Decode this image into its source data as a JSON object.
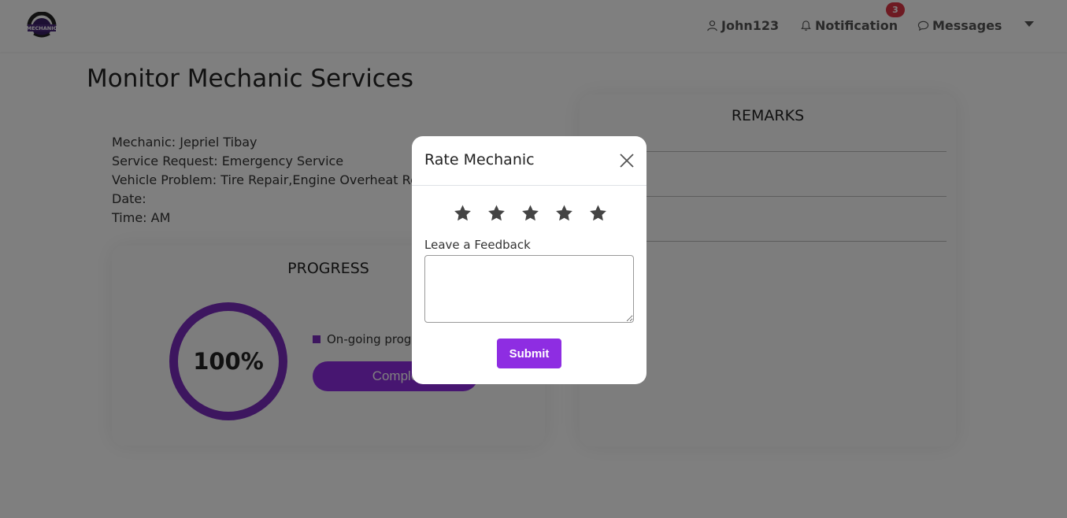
{
  "navbar": {
    "user_label": "John123",
    "notification_label": "Notification",
    "notification_count": "3",
    "messages_label": "Messages",
    "logo_text": "MECHANIC"
  },
  "page": {
    "title": "Monitor Mechanic Services"
  },
  "service_info": {
    "mechanic": "Mechanic: Jepriel Tibay",
    "service_request": "Service Request: Emergency Service",
    "vehicle_problem": "Vehicle Problem: Tire Repair,Engine Overheat Re",
    "date": "Date:",
    "time": "Time: AM"
  },
  "progress": {
    "title": "PROGRESS",
    "percent_label": "100%",
    "percent_value": 100,
    "legend_label": "On-going progr",
    "button_label": "Comple",
    "accent_color": "#7b2cbf"
  },
  "remarks": {
    "title": "REMARKS",
    "fragment": "."
  },
  "modal": {
    "title": "Rate Mechanic",
    "rating": 0,
    "max_rating": 5,
    "feedback_label": "Leave a Feedback",
    "feedback_value": "",
    "submit_label": "Submit",
    "button_color": "#8e2de2"
  }
}
